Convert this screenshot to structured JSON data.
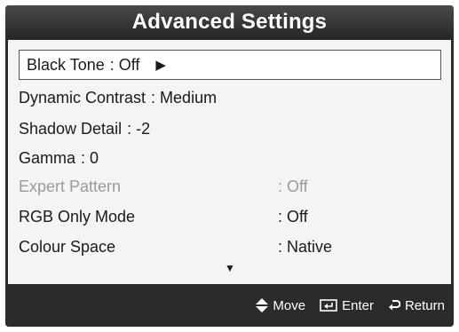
{
  "title": "Advanced Settings",
  "items": [
    {
      "label": "Black Tone",
      "value": ": Off"
    },
    {
      "label": "Dynamic Contrast",
      "value": ": Medium"
    },
    {
      "label": "Shadow Detail",
      "value": ": -2"
    },
    {
      "label": "Gamma",
      "value": ": 0"
    },
    {
      "label": "Expert Pattern",
      "value": ": Off"
    },
    {
      "label": "RGB Only Mode",
      "value": ": Off"
    },
    {
      "label": "Colour Space",
      "value": ": Native"
    }
  ],
  "selected_arrow": "▶",
  "scroll_indicator": "▼",
  "footer": {
    "move_label": "Move",
    "enter_label": "Enter",
    "return_label": "Return",
    "move_icon": "up-down-arrows-icon",
    "enter_icon": "enter-icon",
    "return_icon": "return-icon"
  },
  "colors": {
    "frame": "#2b2b2b",
    "panel": "#f4f4f4",
    "disabled_text": "#9a9a9a"
  }
}
